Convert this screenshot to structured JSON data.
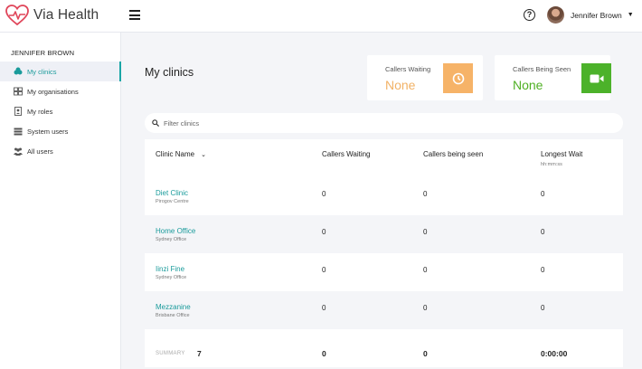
{
  "app": {
    "brand": "Via Health",
    "brand_color": "#e0465a",
    "accent": "#1a9b9b"
  },
  "header": {
    "menu_icon": "hamburger-icon",
    "help_icon": "question-circle-icon",
    "user_name": "Jennifer Brown",
    "user_menu_icon": "chevron-down-icon"
  },
  "sidebar": {
    "heading": "JENNIFER BROWN",
    "items": [
      {
        "label": "My clinics",
        "icon": "clinics-icon",
        "active": true
      },
      {
        "label": "My organisations",
        "icon": "organisations-icon",
        "active": false
      },
      {
        "label": "My roles",
        "icon": "roles-icon",
        "active": false
      },
      {
        "label": "System users",
        "icon": "system-users-icon",
        "active": false
      },
      {
        "label": "All users",
        "icon": "all-users-icon",
        "active": false
      }
    ]
  },
  "main": {
    "title": "My clinics",
    "stats": {
      "waiting": {
        "label": "Callers Waiting",
        "value": "None",
        "icon": "clock-icon",
        "color": "#f6b368"
      },
      "seen": {
        "label": "Callers Being Seen",
        "value": "None",
        "icon": "video-camera-icon",
        "color": "#4cb22a"
      }
    },
    "filter": {
      "placeholder": "Filter clinics",
      "value": "",
      "icon": "search-icon"
    },
    "table": {
      "headers": {
        "name": "Clinic Name",
        "waiting": "Callers Waiting",
        "seen": "Callers being seen",
        "longest": "Longest Wait",
        "longest_sub": "hh:mm:ss"
      },
      "rows": [
        {
          "name": "Diet Clinic",
          "sub": "Pirogov Centre",
          "waiting": "0",
          "seen": "0",
          "longest": "0"
        },
        {
          "name": "Home Office",
          "sub": "Sydney Office",
          "waiting": "0",
          "seen": "0",
          "longest": "0"
        },
        {
          "name": "Iinzi Fine",
          "sub": "Sydney Office",
          "waiting": "0",
          "seen": "0",
          "longest": "0"
        },
        {
          "name": "Mezzanine",
          "sub": "Brisbane Office",
          "waiting": "0",
          "seen": "0",
          "longest": "0"
        }
      ],
      "summary": {
        "label": "SUMMARY",
        "count": "7",
        "waiting": "0",
        "seen": "0",
        "longest": "0:00:00"
      }
    }
  }
}
